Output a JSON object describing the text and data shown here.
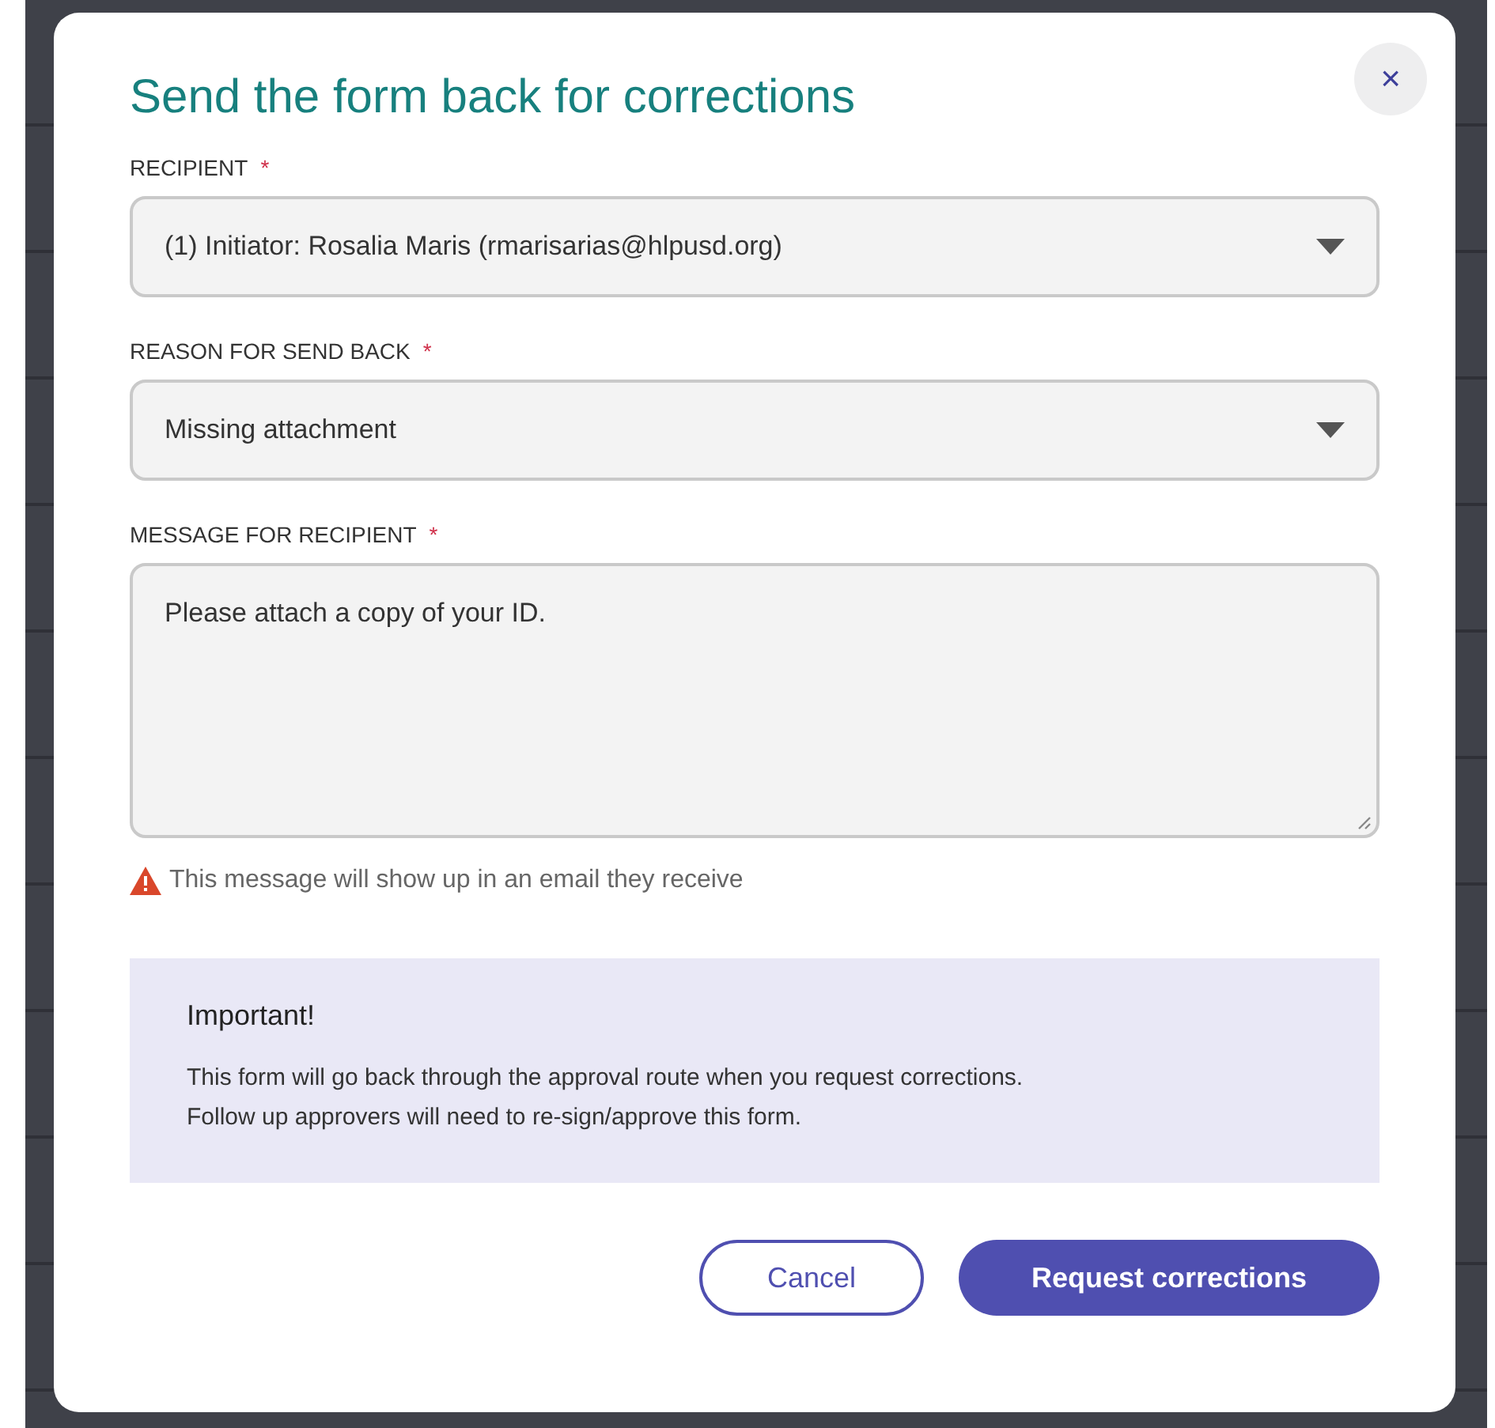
{
  "dialog": {
    "title": "Send the form back for corrections",
    "close_label": "×",
    "fields": [
      {
        "kind": "select",
        "label": "RECIPIENT",
        "required_mark": "*",
        "value": "(1) Initiator: Rosalia Maris (rmarisarias@hlpusd.org)"
      },
      {
        "kind": "select",
        "label": "REASON FOR SEND BACK",
        "required_mark": "*",
        "value": "Missing attachment"
      },
      {
        "kind": "textarea",
        "label": "MESSAGE FOR RECIPIENT",
        "required_mark": "*",
        "value": "Please attach a copy of your ID."
      }
    ],
    "warning": "This message will show up in an email they receive",
    "notice": {
      "title": "Important!",
      "lines": [
        "This form will go back through the approval route when you request corrections.",
        "Follow up approvers will need to re-sign/approve this form."
      ]
    },
    "buttons": [
      {
        "kind": "secondary",
        "label": "Cancel"
      },
      {
        "kind": "primary",
        "label": "Request corrections"
      }
    ]
  }
}
